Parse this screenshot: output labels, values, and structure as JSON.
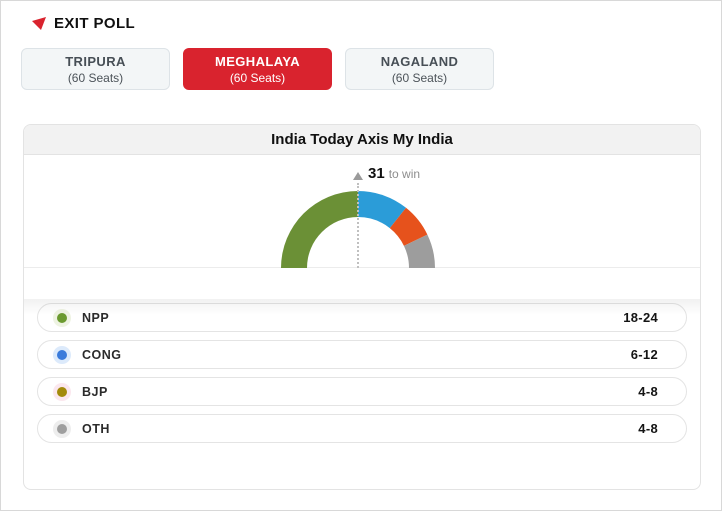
{
  "header": {
    "title": "EXIT POLL"
  },
  "tabs": [
    {
      "label": "TRIPURA",
      "sub": "(60 Seats)",
      "selected": false
    },
    {
      "label": "MEGHALAYA",
      "sub": "(60 Seats)",
      "selected": true
    },
    {
      "label": "NAGALAND",
      "sub": "(60 Seats)",
      "selected": false
    }
  ],
  "card": {
    "title": "India Today Axis My India",
    "marker": {
      "value": "31",
      "suffix": "to win"
    }
  },
  "chart_data": {
    "type": "half-donut-gauge",
    "title": "India Today Axis My India",
    "total_seats": 60,
    "majority_mark": 31,
    "legend_position": "below",
    "parties": [
      {
        "name": "NPP",
        "range": "18-24",
        "low": 18,
        "high": 24,
        "color": "#6b9036",
        "dot_color": "#6b9a2f",
        "halo": "#eef3e2"
      },
      {
        "name": "CONG",
        "range": "6-12",
        "low": 6,
        "high": 12,
        "color": "#2b9cd8",
        "dot_color": "#3a7bdb",
        "halo": "#dceafb"
      },
      {
        "name": "BJP",
        "range": "4-8",
        "low": 4,
        "high": 8,
        "color": "#e6521c",
        "dot_color": "#a38a0a",
        "halo": "#fbe7ee"
      },
      {
        "name": "OTH",
        "range": "4-8",
        "low": 4,
        "high": 8,
        "color": "#9d9d9d",
        "dot_color": "#9e9e9e",
        "halo": "#ededed"
      }
    ]
  },
  "colors": {
    "accent_red": "#d9232e"
  }
}
